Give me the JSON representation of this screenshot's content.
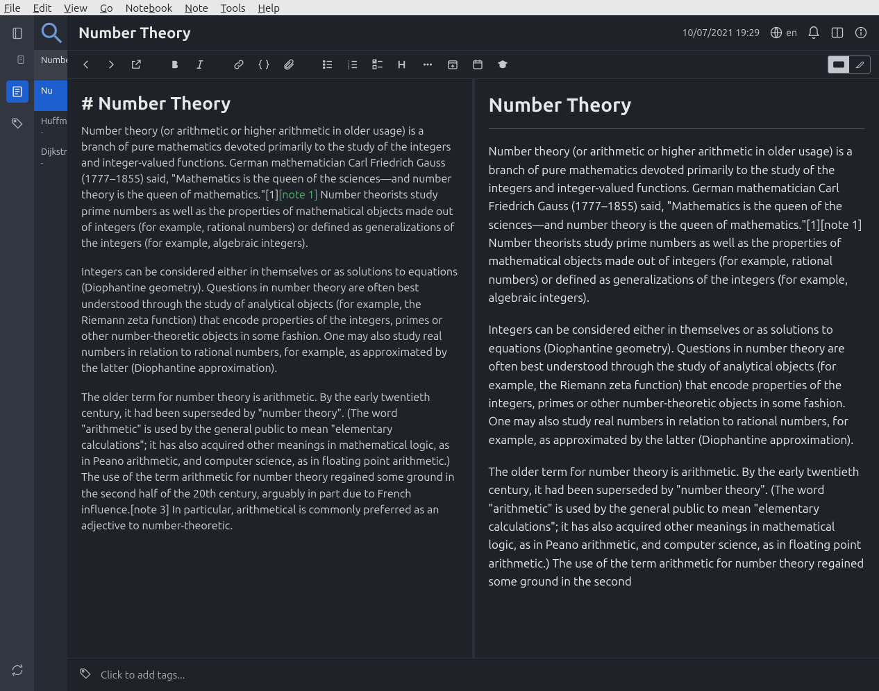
{
  "menubar": [
    "File",
    "Edit",
    "View",
    "Go",
    "Notebook",
    "Note",
    "Tools",
    "Help"
  ],
  "menubar_accel": [
    0,
    0,
    0,
    0,
    4,
    0,
    0,
    0
  ],
  "header": {
    "title": "Number Theory",
    "timestamp": "10/07/2021 19:29",
    "lang": "en"
  },
  "notelist": {
    "items": [
      {
        "title": "Number Theory",
        "sub": "",
        "active": true
      },
      {
        "title": "Nu",
        "sub": "",
        "blue": true
      },
      {
        "title": "Huffman",
        "sub": "-"
      },
      {
        "title": "Dijkstra",
        "sub": "-"
      }
    ]
  },
  "editor": {
    "h1": "# Number Theory",
    "p1a": "Number theory (or arithmetic or higher arithmetic in older usage) is a branch of pure mathematics devoted primarily to the study of the integers and integer-valued functions. German mathematician Carl Friedrich Gauss (1777–1855) said, \"Mathematics is the queen of the sciences—and number theory is the queen of mathematics.\"[1]",
    "p1link": "[note 1]",
    "p1b": " Number theorists study prime numbers as well as the properties of mathematical objects made out of integers (for example, rational numbers) or defined as generalizations of the integers (for example, algebraic integers).",
    "p2": "Integers can be considered either in themselves or as solutions to equations (Diophantine geometry). Questions in number theory are often best understood through the study of analytical objects (for example, the Riemann zeta function) that encode properties of the integers, primes or other number-theoretic objects in some fashion. One may also study real numbers in relation to rational numbers, for example, as approximated by the latter (Diophantine approximation).",
    "p3": "The older term for number theory is arithmetic. By the early twentieth century, it had been superseded by \"number theory\". (The word \"arithmetic\" is used by the general public to mean \"elementary calculations\"; it has also acquired other meanings in mathematical logic, as in Peano arithmetic, and computer science, as in floating point arithmetic.) The use of the term arithmetic for number theory regained some ground in the second half of the 20th century, arguably in part due to French influence.[note 3] In particular, arithmetical is commonly preferred as an adjective to number-theoretic."
  },
  "preview": {
    "h1": "Number Theory",
    "p1": "Number theory (or arithmetic or higher arithmetic in older usage) is a branch of pure mathematics devoted primarily to the study of the integers and integer-valued functions. German mathematician Carl Friedrich Gauss (1777–1855) said, \"Mathematics is the queen of the sciences—and number theory is the queen of mathematics.\"[1][note 1] Number theorists study prime numbers as well as the properties of mathematical objects made out of integers (for example, rational numbers) or defined as generalizations of the integers (for example, algebraic integers).",
    "p2": "Integers can be considered either in themselves or as solutions to equations (Diophantine geometry). Questions in number theory are often best understood through the study of analytical objects (for example, the Riemann zeta function) that encode properties of the integers, primes or other number-theoretic objects in some fashion. One may also study real numbers in relation to rational numbers, for example, as approximated by the latter (Diophantine approximation).",
    "p3": "The older term for number theory is arithmetic. By the early twentieth century, it had been superseded by \"number theory\". (The word \"arithmetic\" is used by the general public to mean \"elementary calculations\"; it has also acquired other meanings in mathematical logic, as in Peano arithmetic, and computer science, as in floating point arithmetic.) The use of the term arithmetic for number theory regained some ground in the second"
  },
  "footer": {
    "tags_placeholder": "Click to add tags..."
  }
}
